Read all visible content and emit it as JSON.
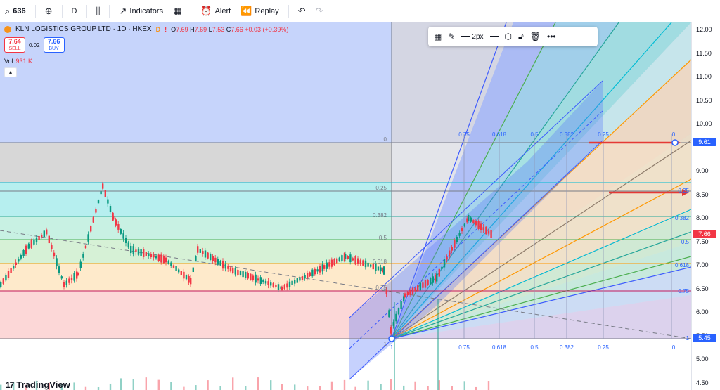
{
  "toolbar": {
    "symbol": "636",
    "interval": "D",
    "indicators_label": "Indicators",
    "alert_label": "Alert",
    "replay_label": "Replay"
  },
  "legend": {
    "title": "KLN LOGISTICS GROUP LTD · 1D · HKEX",
    "tag_d": "D",
    "tag_e": "!",
    "ohlc": [
      {
        "k": "O",
        "v": "7.69"
      },
      {
        "k": "H",
        "v": "7.69"
      },
      {
        "k": "L",
        "v": "7.53"
      },
      {
        "k": "C",
        "v": "7.66"
      }
    ],
    "change": "+0.03 (+0.39%)",
    "sell_price": "7.64",
    "sell_label": "SELL",
    "spread": "0.02",
    "buy_price": "7.66",
    "buy_label": "BUY",
    "vol_label": "Vol",
    "vol_value": "931 K"
  },
  "draw_toolbar": {
    "width_label": "2px"
  },
  "price_axis": {
    "ticks": [
      "12.00",
      "11.50",
      "11.00",
      "10.50",
      "10.00",
      "9.00",
      "8.50",
      "8.00",
      "7.50",
      "7.00",
      "6.50",
      "6.00",
      "5.50",
      "5.00",
      "4.50"
    ],
    "badges": [
      {
        "value": "9.61",
        "color": "#2962ff"
      },
      {
        "value": "7.66",
        "color": "#f23645"
      },
      {
        "value": "5.45",
        "color": "#2962ff"
      }
    ]
  },
  "fib": {
    "retracement_levels": [
      "0",
      "0.25",
      "0.382",
      "0.5",
      "0.618",
      "0.75",
      "1"
    ],
    "fan_labels": [
      "0.75",
      "0.618",
      "0.5",
      "0.382",
      "0.25",
      "0"
    ],
    "right_labels": [
      "0.25",
      "0.382",
      "0.5",
      "0.618",
      "0.75",
      "1"
    ],
    "bottom_labels": [
      "1",
      "0.75",
      "0.618",
      "0.5",
      "0.382",
      "0.25",
      "0"
    ]
  },
  "colors": {
    "up": "#089981",
    "down": "#f23645",
    "accent": "#2962ff"
  },
  "watermark": "TradingView"
}
